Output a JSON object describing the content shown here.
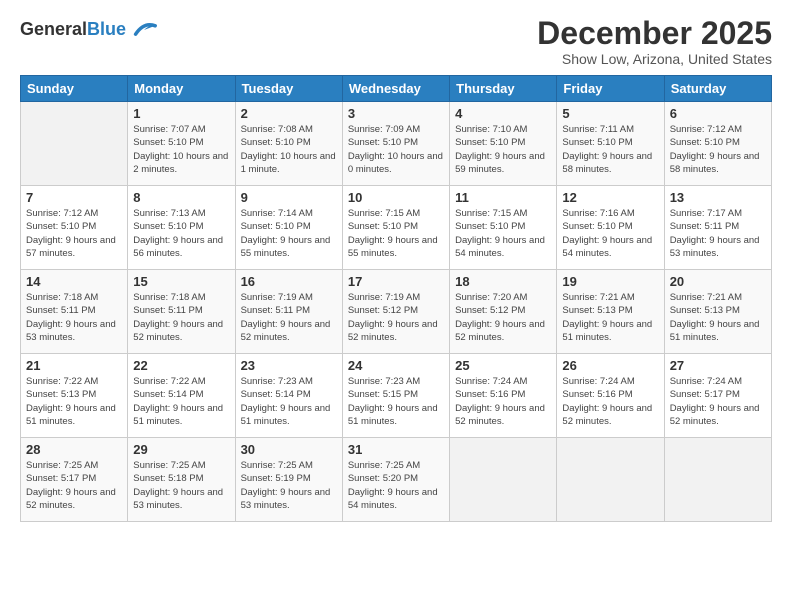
{
  "logo": {
    "general": "General",
    "blue": "Blue"
  },
  "title": "December 2025",
  "location": "Show Low, Arizona, United States",
  "days_header": [
    "Sunday",
    "Monday",
    "Tuesday",
    "Wednesday",
    "Thursday",
    "Friday",
    "Saturday"
  ],
  "weeks": [
    [
      {
        "num": "",
        "sunrise": "",
        "sunset": "",
        "daylight": ""
      },
      {
        "num": "1",
        "sunrise": "Sunrise: 7:07 AM",
        "sunset": "Sunset: 5:10 PM",
        "daylight": "Daylight: 10 hours and 2 minutes."
      },
      {
        "num": "2",
        "sunrise": "Sunrise: 7:08 AM",
        "sunset": "Sunset: 5:10 PM",
        "daylight": "Daylight: 10 hours and 1 minute."
      },
      {
        "num": "3",
        "sunrise": "Sunrise: 7:09 AM",
        "sunset": "Sunset: 5:10 PM",
        "daylight": "Daylight: 10 hours and 0 minutes."
      },
      {
        "num": "4",
        "sunrise": "Sunrise: 7:10 AM",
        "sunset": "Sunset: 5:10 PM",
        "daylight": "Daylight: 9 hours and 59 minutes."
      },
      {
        "num": "5",
        "sunrise": "Sunrise: 7:11 AM",
        "sunset": "Sunset: 5:10 PM",
        "daylight": "Daylight: 9 hours and 58 minutes."
      },
      {
        "num": "6",
        "sunrise": "Sunrise: 7:12 AM",
        "sunset": "Sunset: 5:10 PM",
        "daylight": "Daylight: 9 hours and 58 minutes."
      }
    ],
    [
      {
        "num": "7",
        "sunrise": "Sunrise: 7:12 AM",
        "sunset": "Sunset: 5:10 PM",
        "daylight": "Daylight: 9 hours and 57 minutes."
      },
      {
        "num": "8",
        "sunrise": "Sunrise: 7:13 AM",
        "sunset": "Sunset: 5:10 PM",
        "daylight": "Daylight: 9 hours and 56 minutes."
      },
      {
        "num": "9",
        "sunrise": "Sunrise: 7:14 AM",
        "sunset": "Sunset: 5:10 PM",
        "daylight": "Daylight: 9 hours and 55 minutes."
      },
      {
        "num": "10",
        "sunrise": "Sunrise: 7:15 AM",
        "sunset": "Sunset: 5:10 PM",
        "daylight": "Daylight: 9 hours and 55 minutes."
      },
      {
        "num": "11",
        "sunrise": "Sunrise: 7:15 AM",
        "sunset": "Sunset: 5:10 PM",
        "daylight": "Daylight: 9 hours and 54 minutes."
      },
      {
        "num": "12",
        "sunrise": "Sunrise: 7:16 AM",
        "sunset": "Sunset: 5:10 PM",
        "daylight": "Daylight: 9 hours and 54 minutes."
      },
      {
        "num": "13",
        "sunrise": "Sunrise: 7:17 AM",
        "sunset": "Sunset: 5:11 PM",
        "daylight": "Daylight: 9 hours and 53 minutes."
      }
    ],
    [
      {
        "num": "14",
        "sunrise": "Sunrise: 7:18 AM",
        "sunset": "Sunset: 5:11 PM",
        "daylight": "Daylight: 9 hours and 53 minutes."
      },
      {
        "num": "15",
        "sunrise": "Sunrise: 7:18 AM",
        "sunset": "Sunset: 5:11 PM",
        "daylight": "Daylight: 9 hours and 52 minutes."
      },
      {
        "num": "16",
        "sunrise": "Sunrise: 7:19 AM",
        "sunset": "Sunset: 5:11 PM",
        "daylight": "Daylight: 9 hours and 52 minutes."
      },
      {
        "num": "17",
        "sunrise": "Sunrise: 7:19 AM",
        "sunset": "Sunset: 5:12 PM",
        "daylight": "Daylight: 9 hours and 52 minutes."
      },
      {
        "num": "18",
        "sunrise": "Sunrise: 7:20 AM",
        "sunset": "Sunset: 5:12 PM",
        "daylight": "Daylight: 9 hours and 52 minutes."
      },
      {
        "num": "19",
        "sunrise": "Sunrise: 7:21 AM",
        "sunset": "Sunset: 5:13 PM",
        "daylight": "Daylight: 9 hours and 51 minutes."
      },
      {
        "num": "20",
        "sunrise": "Sunrise: 7:21 AM",
        "sunset": "Sunset: 5:13 PM",
        "daylight": "Daylight: 9 hours and 51 minutes."
      }
    ],
    [
      {
        "num": "21",
        "sunrise": "Sunrise: 7:22 AM",
        "sunset": "Sunset: 5:13 PM",
        "daylight": "Daylight: 9 hours and 51 minutes."
      },
      {
        "num": "22",
        "sunrise": "Sunrise: 7:22 AM",
        "sunset": "Sunset: 5:14 PM",
        "daylight": "Daylight: 9 hours and 51 minutes."
      },
      {
        "num": "23",
        "sunrise": "Sunrise: 7:23 AM",
        "sunset": "Sunset: 5:14 PM",
        "daylight": "Daylight: 9 hours and 51 minutes."
      },
      {
        "num": "24",
        "sunrise": "Sunrise: 7:23 AM",
        "sunset": "Sunset: 5:15 PM",
        "daylight": "Daylight: 9 hours and 51 minutes."
      },
      {
        "num": "25",
        "sunrise": "Sunrise: 7:24 AM",
        "sunset": "Sunset: 5:16 PM",
        "daylight": "Daylight: 9 hours and 52 minutes."
      },
      {
        "num": "26",
        "sunrise": "Sunrise: 7:24 AM",
        "sunset": "Sunset: 5:16 PM",
        "daylight": "Daylight: 9 hours and 52 minutes."
      },
      {
        "num": "27",
        "sunrise": "Sunrise: 7:24 AM",
        "sunset": "Sunset: 5:17 PM",
        "daylight": "Daylight: 9 hours and 52 minutes."
      }
    ],
    [
      {
        "num": "28",
        "sunrise": "Sunrise: 7:25 AM",
        "sunset": "Sunset: 5:17 PM",
        "daylight": "Daylight: 9 hours and 52 minutes."
      },
      {
        "num": "29",
        "sunrise": "Sunrise: 7:25 AM",
        "sunset": "Sunset: 5:18 PM",
        "daylight": "Daylight: 9 hours and 53 minutes."
      },
      {
        "num": "30",
        "sunrise": "Sunrise: 7:25 AM",
        "sunset": "Sunset: 5:19 PM",
        "daylight": "Daylight: 9 hours and 53 minutes."
      },
      {
        "num": "31",
        "sunrise": "Sunrise: 7:25 AM",
        "sunset": "Sunset: 5:20 PM",
        "daylight": "Daylight: 9 hours and 54 minutes."
      },
      {
        "num": "",
        "sunrise": "",
        "sunset": "",
        "daylight": ""
      },
      {
        "num": "",
        "sunrise": "",
        "sunset": "",
        "daylight": ""
      },
      {
        "num": "",
        "sunrise": "",
        "sunset": "",
        "daylight": ""
      }
    ]
  ]
}
